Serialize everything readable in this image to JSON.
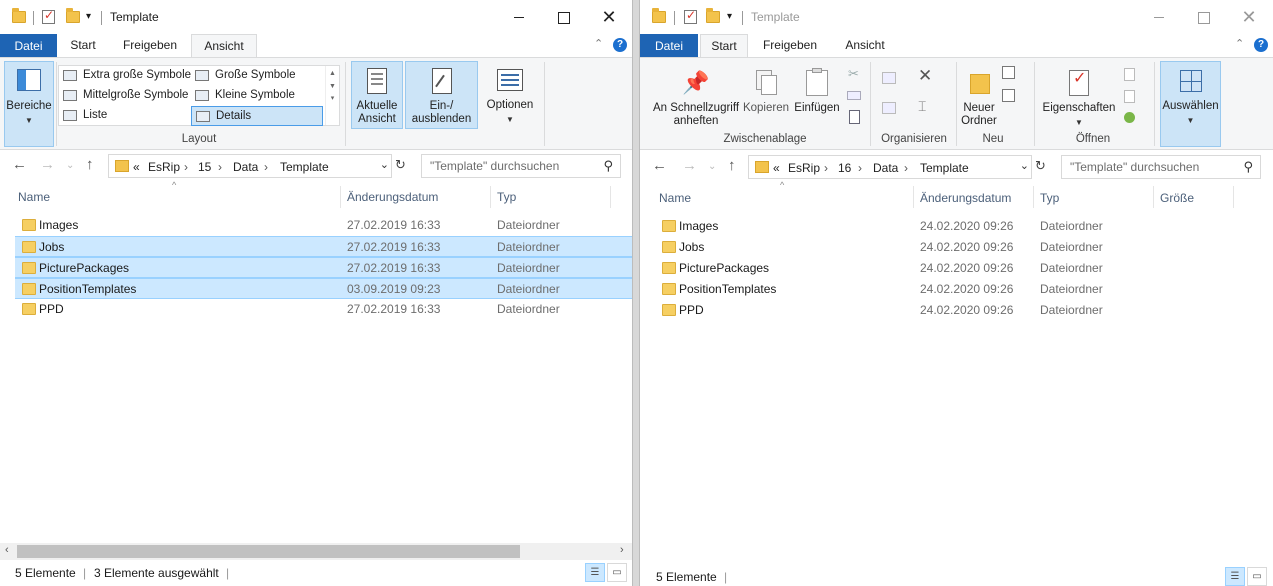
{
  "left": {
    "title": "Template",
    "tabs": [
      "Datei",
      "Start",
      "Freigeben",
      "Ansicht"
    ],
    "active_tab": "Ansicht",
    "help": "?",
    "ribbon": {
      "bereiche": "Bereiche",
      "layout_options": [
        "Extra große Symbole",
        "Große Symbole",
        "Mittelgroße Symbole",
        "Kleine Symbole",
        "Liste",
        "Details"
      ],
      "layout_selected": "Details",
      "layout_label": "Layout",
      "aktuelle_ansicht_1": "Aktuelle",
      "aktuelle_ansicht_2": "Ansicht",
      "ein_ausblenden_1": "Ein-/",
      "ein_ausblenden_2": "ausblenden",
      "optionen": "Optionen"
    },
    "address": {
      "prefix": "«",
      "crumbs": [
        "EsRip",
        "15",
        "Data",
        "Template"
      ]
    },
    "search_placeholder": "\"Template\" durchsuchen",
    "columns": [
      "Name",
      "Änderungsdatum",
      "Typ"
    ],
    "rows": [
      {
        "name": "Images",
        "date": "27.02.2019 16:33",
        "type": "Dateiordner",
        "selected": false
      },
      {
        "name": "Jobs",
        "date": "27.02.2019 16:33",
        "type": "Dateiordner",
        "selected": true
      },
      {
        "name": "PicturePackages",
        "date": "27.02.2019 16:33",
        "type": "Dateiordner",
        "selected": true
      },
      {
        "name": "PositionTemplates",
        "date": "03.09.2019 09:23",
        "type": "Dateiordner",
        "selected": true
      },
      {
        "name": "PPD",
        "date": "27.02.2019 16:33",
        "type": "Dateiordner",
        "selected": false
      }
    ],
    "status_count": "5 Elemente",
    "status_selected": "3 Elemente ausgewählt"
  },
  "right": {
    "title": "Template",
    "tabs": [
      "Datei",
      "Start",
      "Freigeben",
      "Ansicht"
    ],
    "active_tab": "Start",
    "help": "?",
    "ribbon": {
      "pin_1": "An Schnellzugriff",
      "pin_2": "anheften",
      "kopieren": "Kopieren",
      "einfuegen": "Einfügen",
      "zwischenablage": "Zwischenablage",
      "organisieren": "Organisieren",
      "neuer_1": "Neuer",
      "neuer_2": "Ordner",
      "neu": "Neu",
      "eigenschaften": "Eigenschaften",
      "oeffnen": "Öffnen",
      "auswaehlen": "Auswählen"
    },
    "address": {
      "prefix": "«",
      "crumbs": [
        "EsRip",
        "16",
        "Data",
        "Template"
      ]
    },
    "search_placeholder": "\"Template\" durchsuchen",
    "columns": [
      "Name",
      "Änderungsdatum",
      "Typ",
      "Größe"
    ],
    "rows": [
      {
        "name": "Images",
        "date": "24.02.2020 09:26",
        "type": "Dateiordner"
      },
      {
        "name": "Jobs",
        "date": "24.02.2020 09:26",
        "type": "Dateiordner"
      },
      {
        "name": "PicturePackages",
        "date": "24.02.2020 09:26",
        "type": "Dateiordner"
      },
      {
        "name": "PositionTemplates",
        "date": "24.02.2020 09:26",
        "type": "Dateiordner"
      },
      {
        "name": "PPD",
        "date": "24.02.2020 09:26",
        "type": "Dateiordner"
      }
    ],
    "status_count": "5 Elemente"
  }
}
